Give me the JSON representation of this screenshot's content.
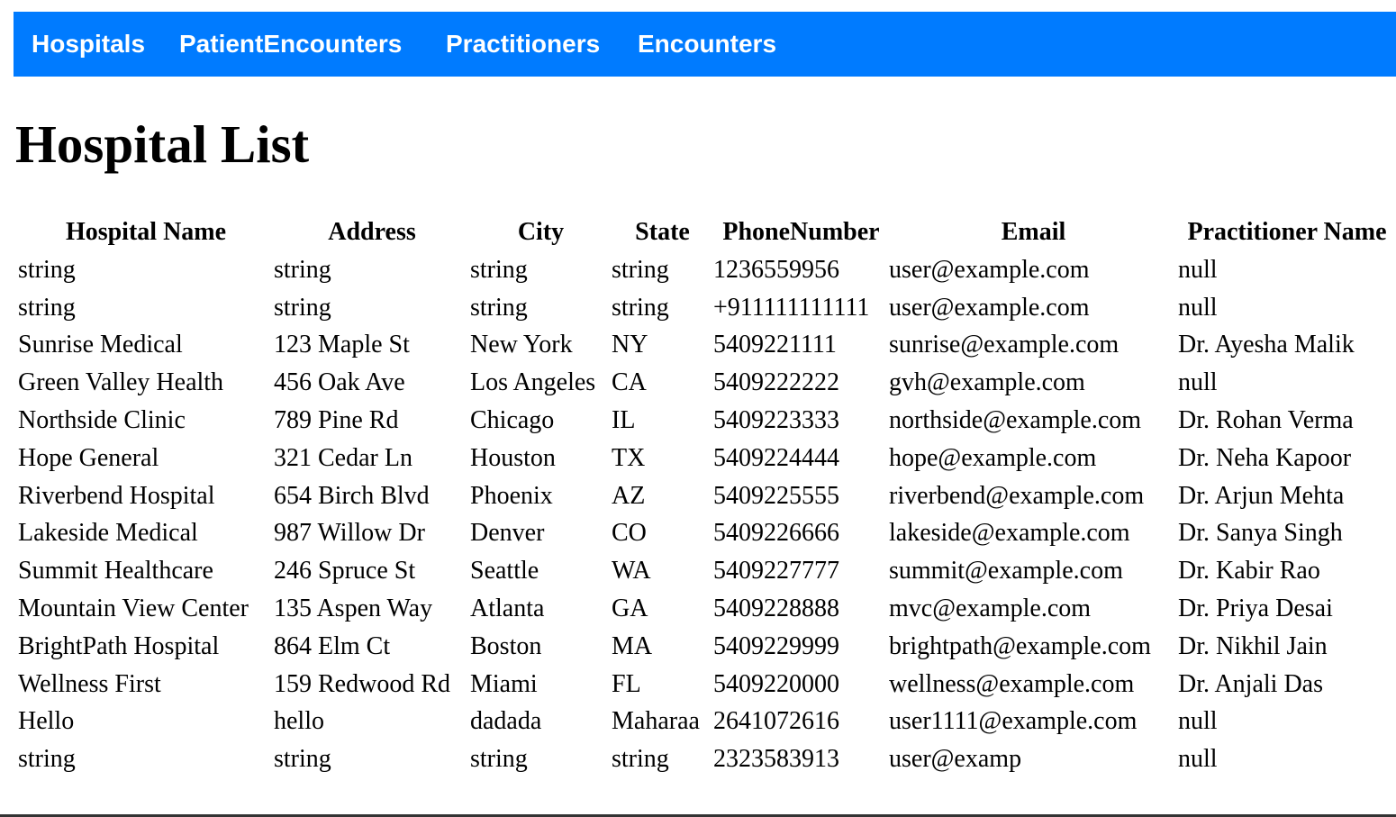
{
  "nav": {
    "bg_color": "#007bff",
    "text_color": "#ffffff",
    "items": [
      {
        "label": "Hospitals"
      },
      {
        "label": "PatientEncounters"
      },
      {
        "label": "Practitioners"
      },
      {
        "label": "Encounters"
      }
    ]
  },
  "page": {
    "title": "Hospital List"
  },
  "table": {
    "headers": [
      "Hospital Name",
      "Address",
      "City",
      "State",
      "PhoneNumber",
      "Email",
      "Practitioner Name"
    ],
    "rows": [
      [
        "string",
        "string",
        "string",
        "string",
        "1236559956",
        "user@example.com",
        "null"
      ],
      [
        "string",
        "string",
        "string",
        "string",
        "+911111111111",
        "user@example.com",
        "null"
      ],
      [
        "Sunrise Medical",
        "123 Maple St",
        "New York",
        "NY",
        "5409221111",
        "sunrise@example.com",
        "Dr. Ayesha Malik"
      ],
      [
        "Green Valley Health",
        "456 Oak Ave",
        "Los Angeles",
        "CA",
        "5409222222",
        "gvh@example.com",
        "null"
      ],
      [
        "Northside Clinic",
        "789 Pine Rd",
        "Chicago",
        "IL",
        "5409223333",
        "northside@example.com",
        "Dr. Rohan Verma"
      ],
      [
        "Hope General",
        "321 Cedar Ln",
        "Houston",
        "TX",
        "5409224444",
        "hope@example.com",
        "Dr. Neha Kapoor"
      ],
      [
        "Riverbend Hospital",
        "654 Birch Blvd",
        "Phoenix",
        "AZ",
        "5409225555",
        "riverbend@example.com",
        "Dr. Arjun Mehta"
      ],
      [
        "Lakeside Medical",
        "987 Willow Dr",
        "Denver",
        "CO",
        "5409226666",
        "lakeside@example.com",
        "Dr. Sanya Singh"
      ],
      [
        "Summit Healthcare",
        "246 Spruce St",
        "Seattle",
        "WA",
        "5409227777",
        "summit@example.com",
        "Dr. Kabir Rao"
      ],
      [
        "Mountain View Center",
        "135 Aspen Way",
        "Atlanta",
        "GA",
        "5409228888",
        "mvc@example.com",
        "Dr. Priya Desai"
      ],
      [
        "BrightPath Hospital",
        "864 Elm Ct",
        "Boston",
        "MA",
        "5409229999",
        "brightpath@example.com",
        "Dr. Nikhil Jain"
      ],
      [
        "Wellness First",
        "159 Redwood Rd",
        "Miami",
        "FL",
        "5409220000",
        "wellness@example.com",
        "Dr. Anjali Das"
      ],
      [
        "Hello",
        "hello",
        "dadada",
        "Maharaa",
        "2641072616",
        "user1111@example.com",
        "null"
      ],
      [
        "string",
        "string",
        "string",
        "string",
        "2323583913",
        "user@examp",
        "null"
      ]
    ]
  }
}
